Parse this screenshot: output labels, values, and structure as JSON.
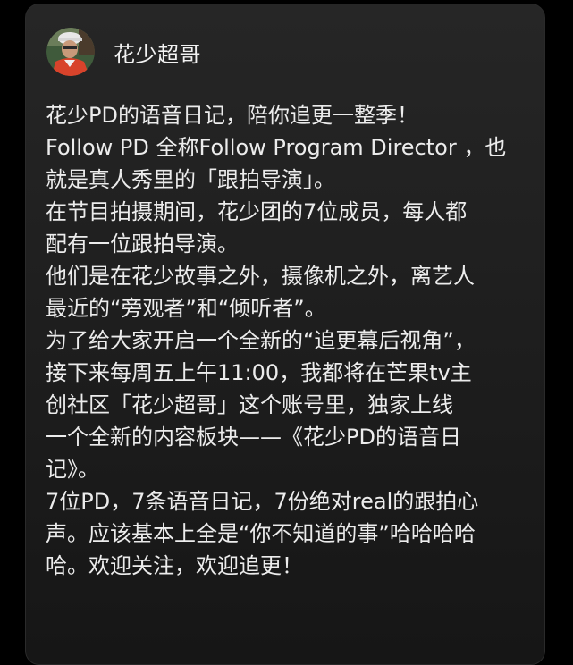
{
  "post": {
    "author_name": "花少超哥",
    "avatar_icon": "user-avatar-photo",
    "lines": [
      "花少PD的语音日记，陪你追更一整季！",
      "Follow PD 全称Follow Program Director ，也",
      "就是真人秀里的「跟拍导演」。",
      "在节目拍摄期间，花少团的7位成员，每人都",
      "配有一位跟拍导演。",
      "他们是在花少故事之外，摄像机之外，离艺人",
      "最近的“旁观者”和“倾听者”。",
      "为了给大家开启一个全新的“追更幕后视角”，",
      "接下来每周五上午11:00，我都将在芒果tv主",
      "创社区「花少超哥」这个账号里，独家上线",
      "一个全新的内容板块——《花少PD的语音日",
      "记》。",
      "7位PD，7条语音日记，7份绝对real的跟拍心",
      "声。应该基本上全是“你不知道的事”哈哈哈哈",
      "哈。欢迎关注，欢迎追更！"
    ]
  },
  "colors": {
    "page_background": "#000000",
    "card_background": "#222222",
    "text": "#ececec",
    "avatar_accent": "#d8432b"
  }
}
